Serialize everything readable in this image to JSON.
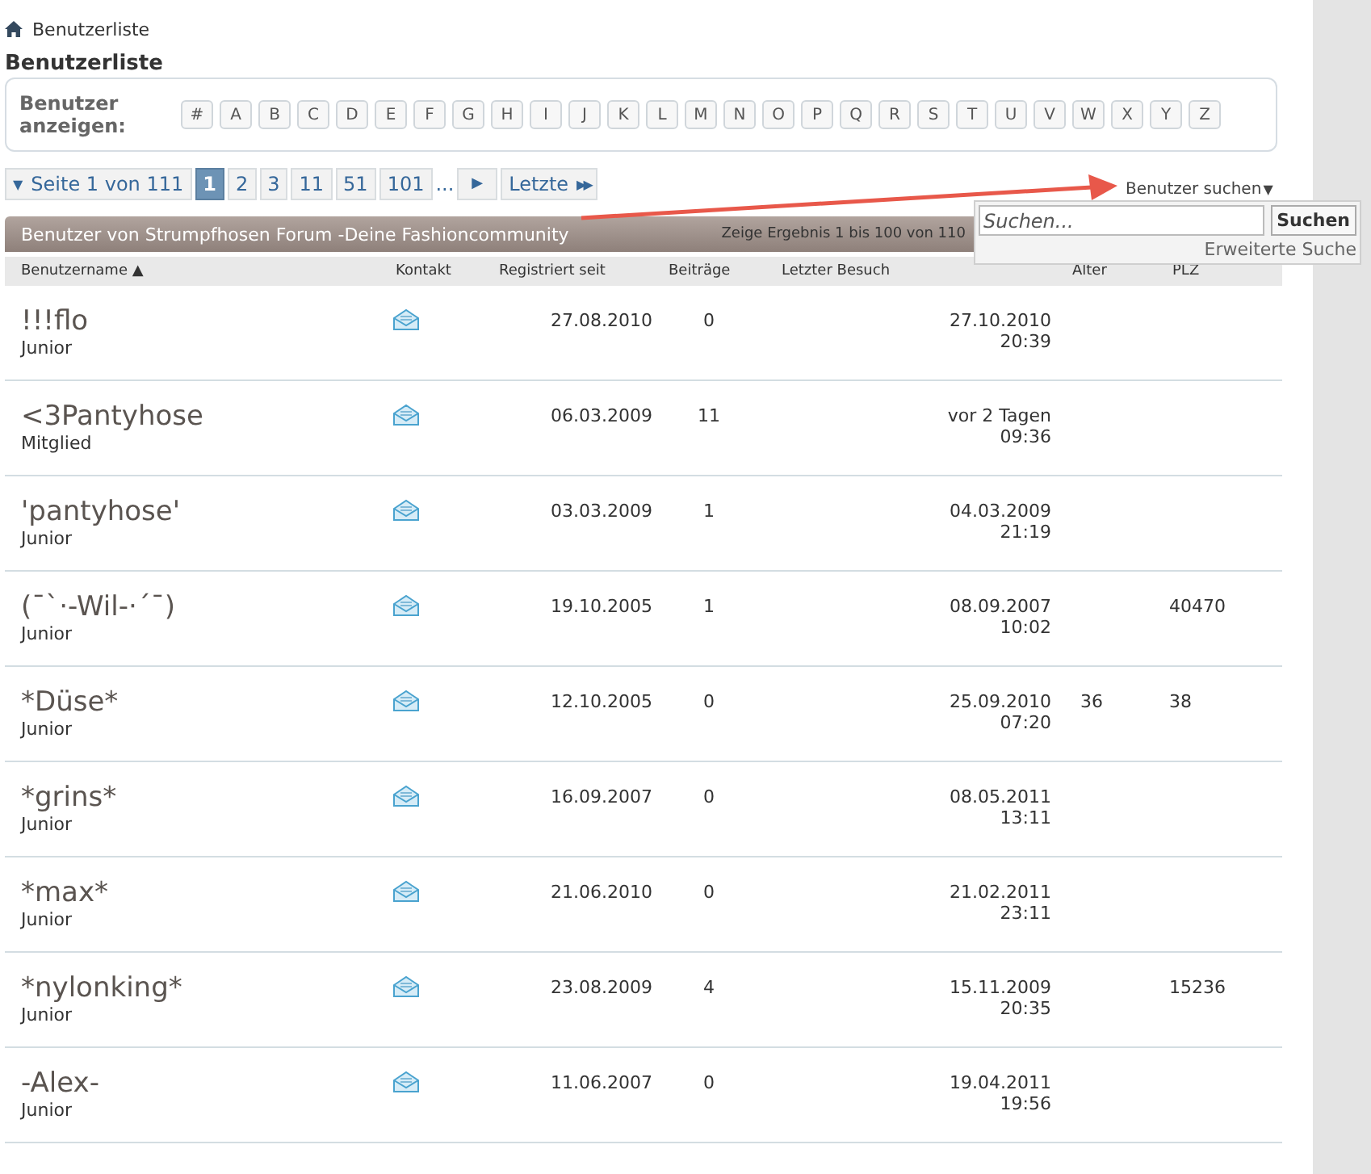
{
  "breadcrumb": {
    "label": "Benutzerliste"
  },
  "title": "Benutzerliste",
  "letter_filter": {
    "label": "Benutzer anzeigen:",
    "letters": [
      "#",
      "A",
      "B",
      "C",
      "D",
      "E",
      "F",
      "G",
      "H",
      "I",
      "J",
      "K",
      "L",
      "M",
      "N",
      "O",
      "P",
      "Q",
      "R",
      "S",
      "T",
      "U",
      "V",
      "W",
      "X",
      "Y",
      "Z"
    ]
  },
  "pagination": {
    "menu_caret": "▼",
    "page_info": "Seite 1 von 111",
    "pages": [
      {
        "label": "1",
        "selected": true
      },
      {
        "label": "2",
        "selected": false
      },
      {
        "label": "3",
        "selected": false
      },
      {
        "label": "11",
        "selected": false
      },
      {
        "label": "51",
        "selected": false
      },
      {
        "label": "101",
        "selected": false
      }
    ],
    "ellipsis": "...",
    "next": "▶",
    "last": "Letzte",
    "last_icon": "▶▶"
  },
  "member_search": {
    "label": "Benutzer suchen",
    "caret": "▼",
    "expanded": true,
    "placeholder": "Suchen...",
    "button": "Suchen",
    "advanced_link": "Erweiterte Suche"
  },
  "table": {
    "title": "Benutzer von Strumpfhosen Forum -Deine Fashioncommunity",
    "result_info": "Zeige Ergebnis 1 bis 100 von 110",
    "columns": [
      {
        "label": "Benutzername",
        "sort_indicator": "▲"
      },
      {
        "label": "Kontakt"
      },
      {
        "label": "Registriert seit"
      },
      {
        "label": "Beiträge"
      },
      {
        "label": "Letzter Besuch"
      },
      {
        "label": "Alter"
      },
      {
        "label": "PLZ"
      }
    ],
    "rows": [
      {
        "name": "!!!flo",
        "rank": "Junior",
        "registered": "27.08.2010",
        "posts": "0",
        "last_visit": "27.10.2010",
        "last_visit_time": "20:39"
      },
      {
        "name": "<3Pantyhose",
        "rank": "Mitglied",
        "registered": "06.03.2009",
        "posts": "11",
        "last_visit": "vor 2 Tagen",
        "last_visit_time": "09:36"
      },
      {
        "name": "'pantyhose'",
        "rank": "Junior",
        "registered": "03.03.2009",
        "posts": "1",
        "last_visit": "04.03.2009",
        "last_visit_time": "21:19"
      },
      {
        "name": "(¯`·-Wil-·´¯)",
        "rank": "Junior",
        "registered": "19.10.2005",
        "posts": "1",
        "last_visit": "08.09.2007",
        "last_visit_time": "10:02",
        "plz": "40470"
      },
      {
        "name": "*Düse*",
        "rank": "Junior",
        "registered": "12.10.2005",
        "posts": "0",
        "last_visit": "25.09.2010",
        "last_visit_time": "07:20",
        "age": "36",
        "plz": "38"
      },
      {
        "name": "*grins*",
        "rank": "Junior",
        "registered": "16.09.2007",
        "posts": "0",
        "last_visit": "08.05.2011",
        "last_visit_time": "13:11"
      },
      {
        "name": "*max*",
        "rank": "Junior",
        "registered": "21.06.2010",
        "posts": "0",
        "last_visit": "21.02.2011",
        "last_visit_time": "23:11"
      },
      {
        "name": "*nylonking*",
        "rank": "Junior",
        "registered": "23.08.2009",
        "posts": "4",
        "last_visit": "15.11.2009",
        "last_visit_time": "20:35",
        "plz": "15236"
      },
      {
        "name": "-Alex-",
        "rank": "Junior",
        "registered": "11.06.2007",
        "posts": "0",
        "last_visit": "19.04.2011",
        "last_visit_time": "19:56"
      }
    ]
  }
}
